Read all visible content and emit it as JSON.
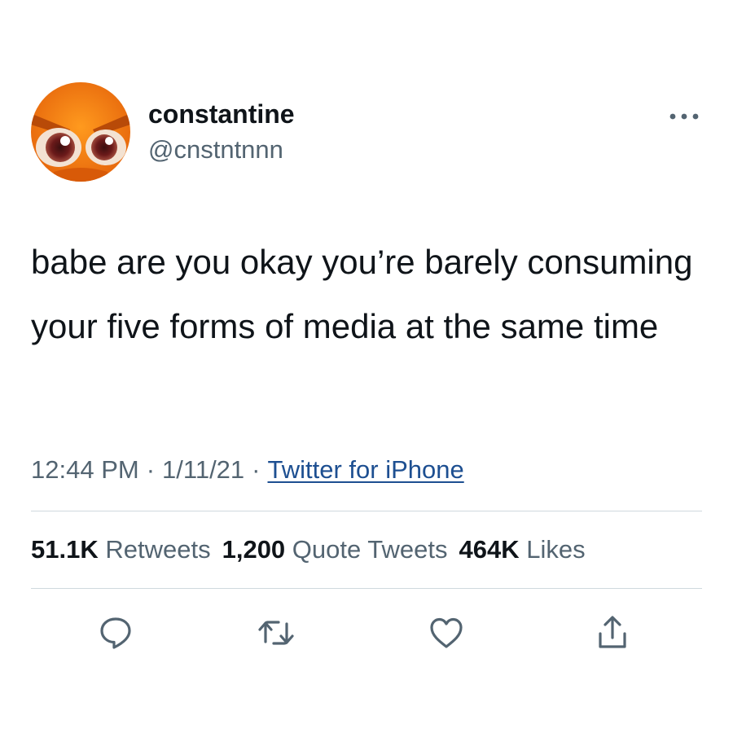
{
  "author": {
    "display_name": "constantine",
    "handle": "@cnstntnnn",
    "avatar_icon": "orange-angry-face-avatar"
  },
  "more_icon": "more-horizontal-icon",
  "tweet": {
    "text": "babe are you okay you’re barely consuming your five forms of media at the same time"
  },
  "meta": {
    "time": "12:44 PM",
    "separator": "·",
    "date": "1/11/21",
    "source": "Twitter for iPhone"
  },
  "stats": {
    "retweets_count": "51.1K",
    "retweets_label": "Retweets",
    "quote_count": "1,200",
    "quote_label": "Quote Tweets",
    "likes_count": "464K",
    "likes_label": "Likes"
  },
  "actions": [
    "reply-icon",
    "retweet-icon",
    "like-icon",
    "share-icon"
  ],
  "colors": {
    "text": "#0f1419",
    "secondary_text": "#536471",
    "link": "#1d4f91",
    "divider": "#cfd9de",
    "avatar_orange": "#f07a12"
  }
}
